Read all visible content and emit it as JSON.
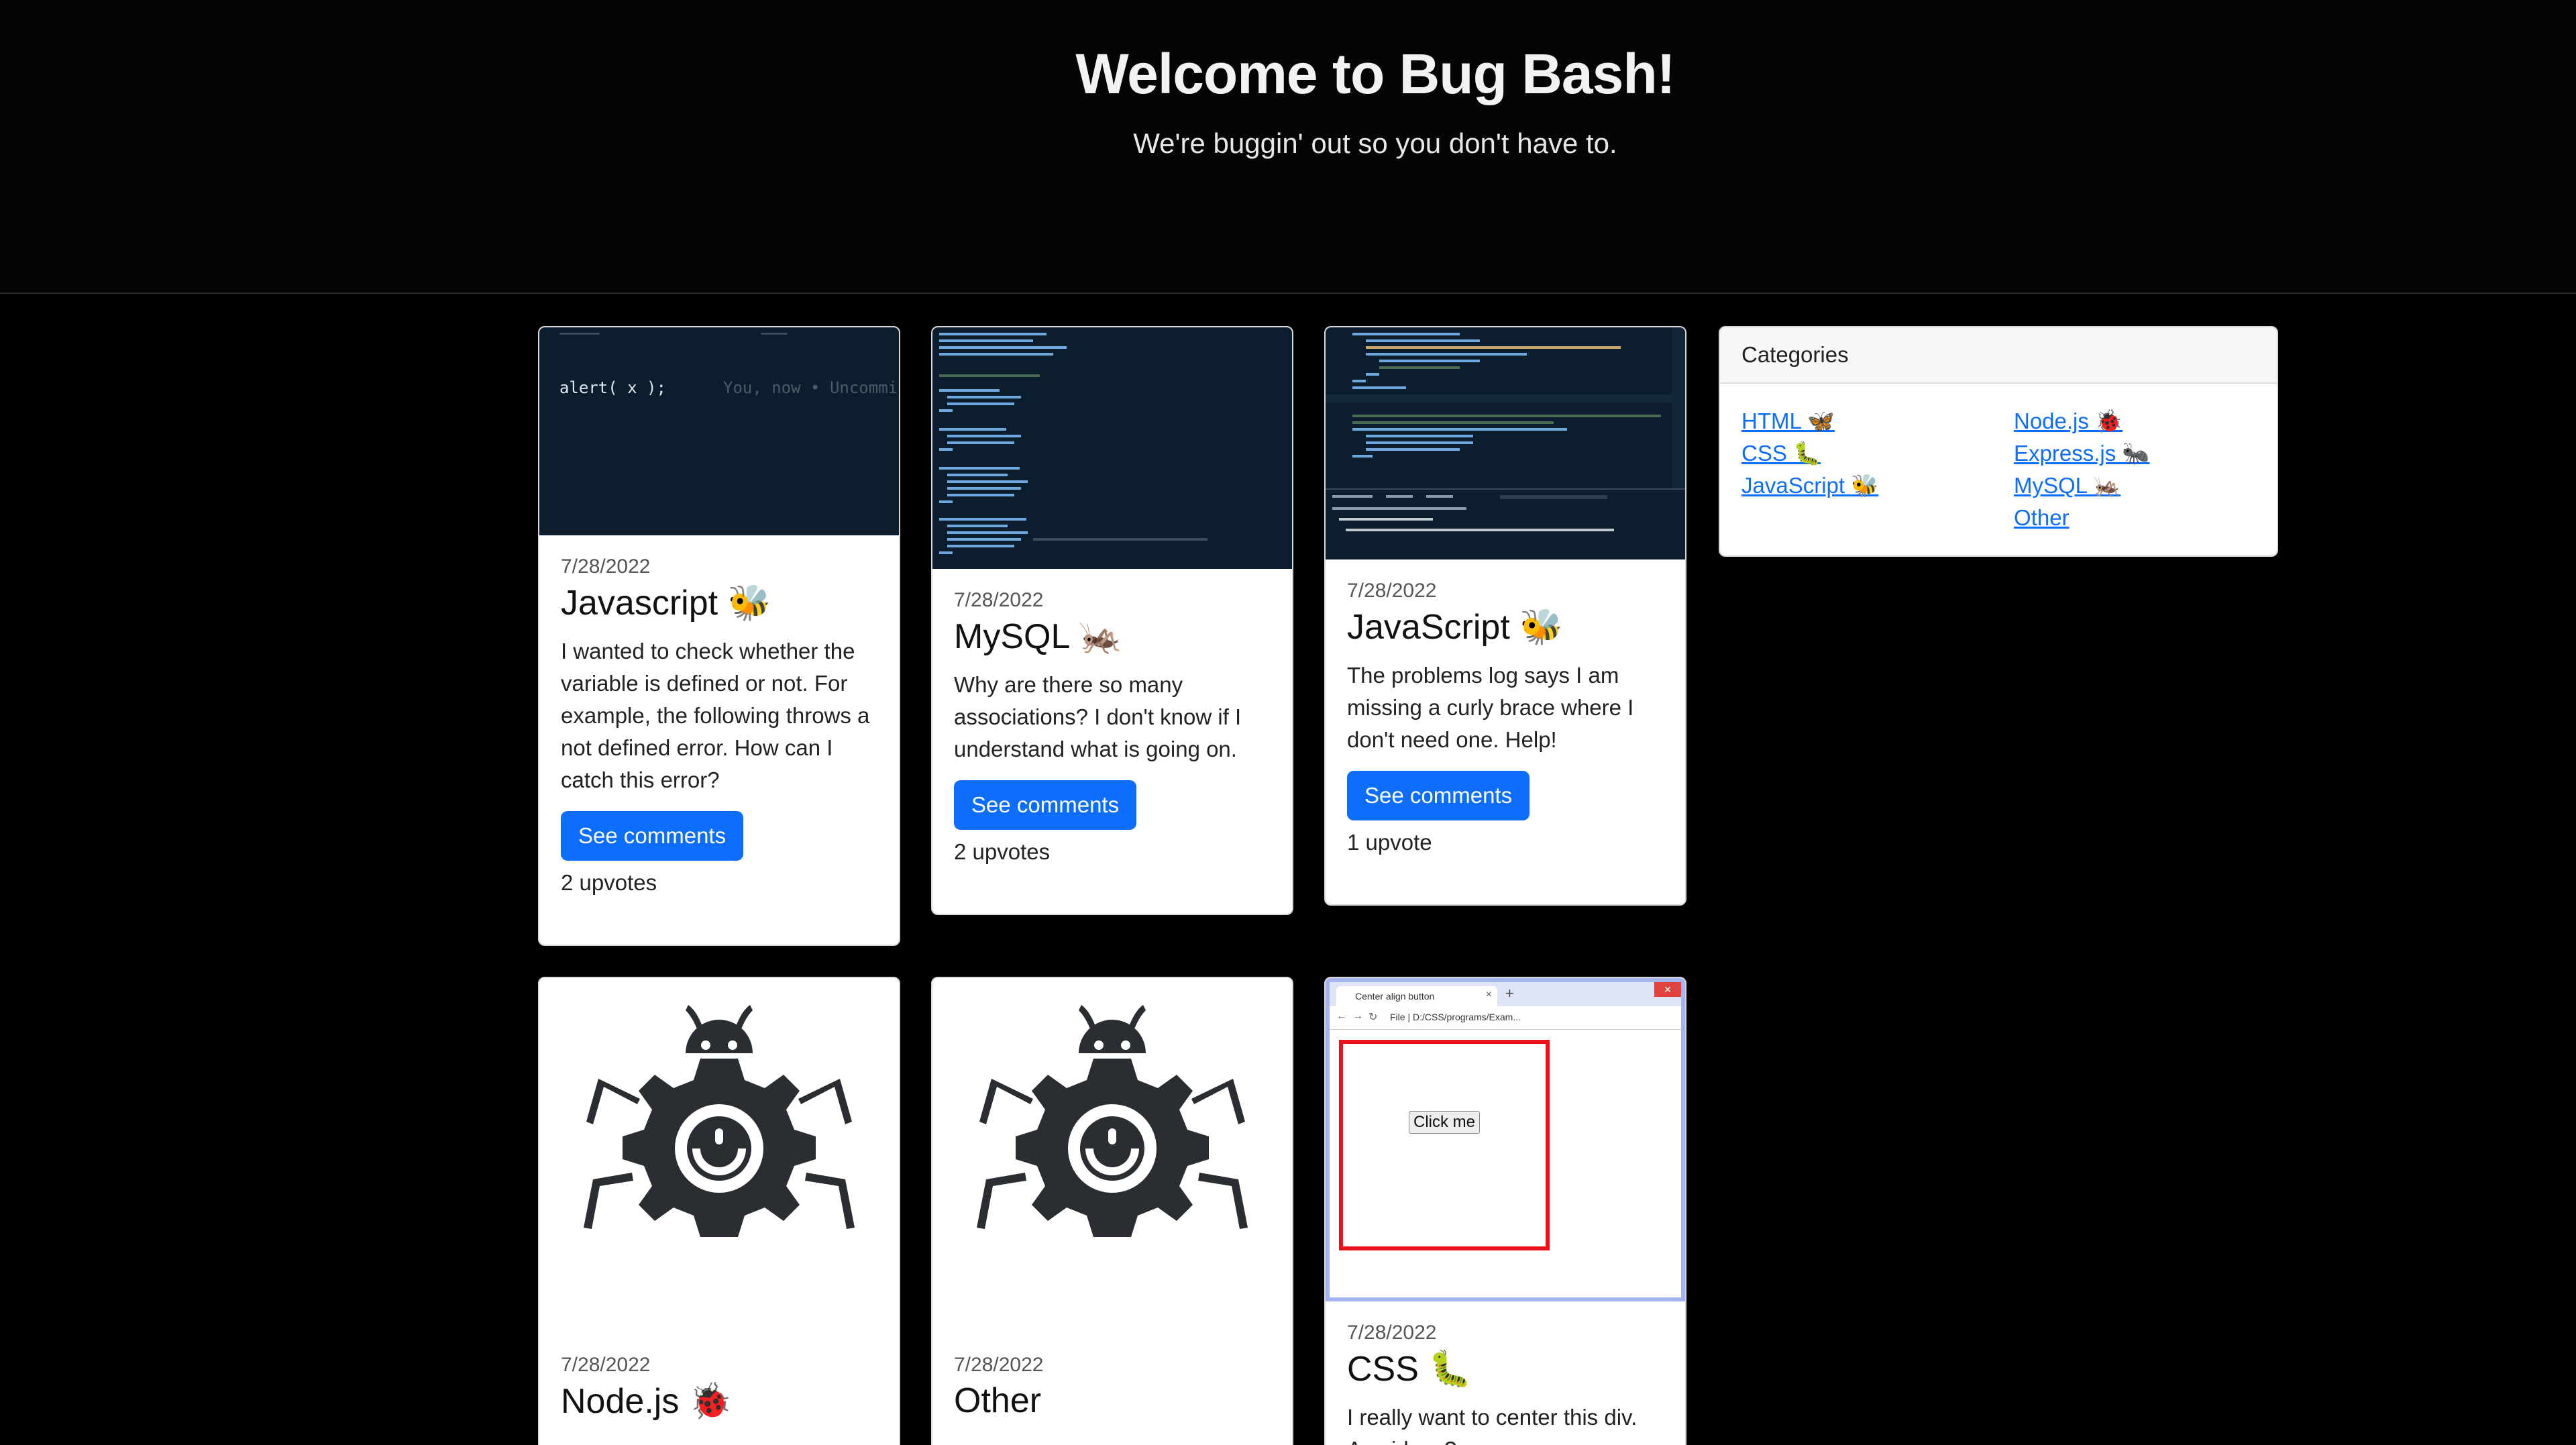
{
  "header": {
    "title": "Welcome to Bug Bash!",
    "subtitle": "We're buggin' out so you don't have to."
  },
  "posts": [
    {
      "date": "7/28/2022",
      "title": "Javascript 🐝",
      "description": "I wanted to check whether the variable is defined or not. For example, the following throws a not defined error. How can I catch this error?",
      "button": "See comments",
      "votes": "2 upvotes",
      "code_text": "alert( x );",
      "code_ghost": "You, now • Uncommit"
    },
    {
      "date": "7/28/2022",
      "title": "MySQL 🦗",
      "description": "Why are there so many associations? I don't know if I understand what is going on.",
      "button": "See comments",
      "votes": "2 upvotes"
    },
    {
      "date": "7/28/2022",
      "title": "JavaScript 🐝",
      "description": "The problems log says I am missing a curly brace where I don't need one. Help!",
      "button": "See comments",
      "votes": "1 upvote"
    },
    {
      "date": "7/28/2022",
      "title": "Node.js 🐞",
      "image_icon": "bug-gear-icon"
    },
    {
      "date": "7/28/2022",
      "title": "Other",
      "image_icon": "bug-gear-icon"
    },
    {
      "date": "7/28/2022",
      "title": "CSS 🐛",
      "description": "I really want to center this div. Any ideas?",
      "browser_tab": "Center align button",
      "browser_url": "File | D:/CSS/programs/Exam...",
      "demo_button": "Click me"
    }
  ],
  "categories": {
    "heading": "Categories",
    "left": [
      "HTML 🦋",
      "CSS 🐛",
      "JavaScript 🐝"
    ],
    "right": [
      "Node.js 🐞",
      "Express.js 🐜",
      "MySQL 🦗",
      "Other"
    ]
  },
  "colors": {
    "accent": "#0d6efd",
    "page_bg": "#000000",
    "code_bg": "#0b1c2c"
  }
}
